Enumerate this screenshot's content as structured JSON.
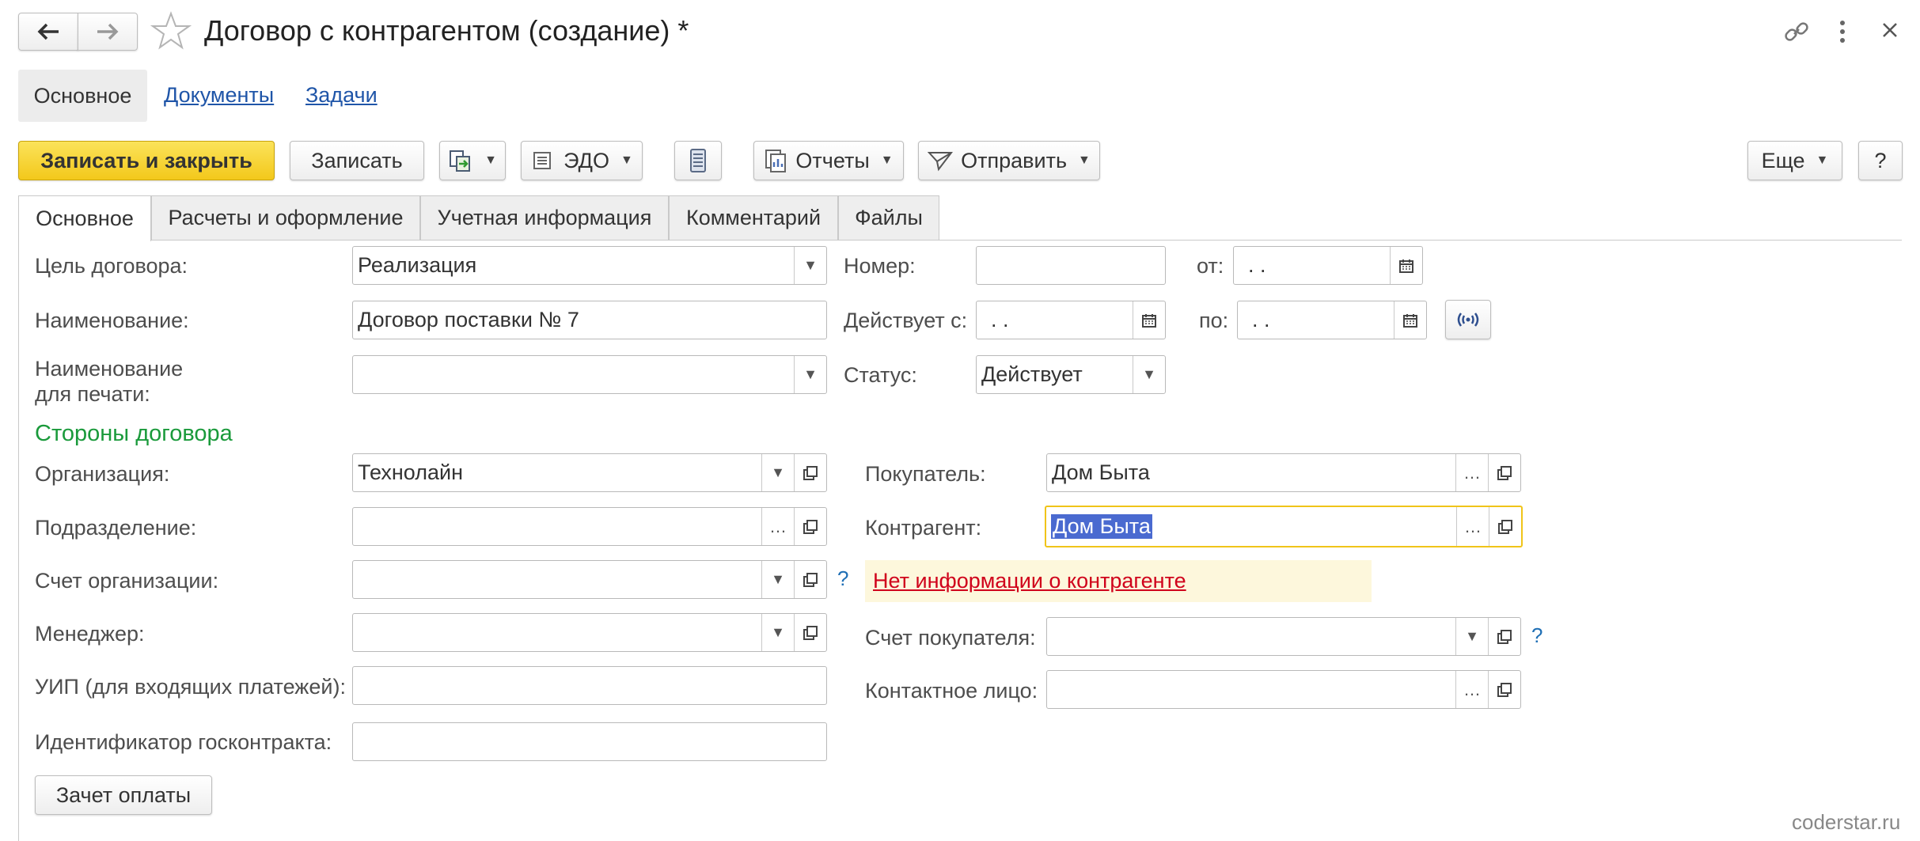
{
  "window": {
    "title": "Договор с контрагентом (создание) *"
  },
  "nav": {
    "items": [
      {
        "label": "Основное",
        "active": true
      },
      {
        "label": "Документы",
        "active": false
      },
      {
        "label": "Задачи",
        "active": false
      }
    ]
  },
  "toolbar": {
    "save_close": "Записать и закрыть",
    "save": "Записать",
    "edo": "ЭДО",
    "reports": "Отчеты",
    "send": "Отправить",
    "more": "Еще",
    "help": "?"
  },
  "tabs": [
    {
      "label": "Основное",
      "active": true
    },
    {
      "label": "Расчеты и оформление",
      "active": false
    },
    {
      "label": "Учетная информация",
      "active": false
    },
    {
      "label": "Комментарий",
      "active": false
    },
    {
      "label": "Файлы",
      "active": false
    }
  ],
  "form": {
    "purpose_label": "Цель договора:",
    "purpose_value": "Реализация",
    "name_label": "Наименование:",
    "name_value": "Договор поставки № 7",
    "print_name_label_1": "Наименование",
    "print_name_label_2": "для печати:",
    "print_name_value": "",
    "number_label": "Номер:",
    "number_value": "",
    "from_label": "от:",
    "from_value": " .  . ",
    "valid_from_label": "Действует с:",
    "valid_from_value": " .  . ",
    "valid_to_label": "по:",
    "valid_to_value": " .  . ",
    "status_label": "Статус:",
    "status_value": "Действует"
  },
  "parties": {
    "heading": "Стороны договора",
    "org_label": "Организация:",
    "org_value": "Технолайн",
    "dept_label": "Подразделение:",
    "dept_value": "",
    "org_account_label": "Счет организации:",
    "org_account_value": "",
    "manager_label": "Менеджер:",
    "manager_value": "",
    "uip_label": "УИП (для входящих платежей):",
    "uip_value": "",
    "gov_id_label": "Идентификатор госконтракта:",
    "gov_id_value": "",
    "buyer_label": "Покупатель:",
    "buyer_value": "Дом Быта",
    "counterparty_label": "Контрагент:",
    "counterparty_value": "Дом Быта",
    "warning": "Нет информации о контрагенте",
    "buyer_account_label": "Счет покупателя:",
    "buyer_account_value": "",
    "contact_label": "Контактное лицо:",
    "contact_value": "",
    "offset_button": "Зачет оплаты",
    "help_mark": "?"
  },
  "footer": {
    "watermark": "coderstar.ru"
  },
  "colors": {
    "accent_yellow": "#f6cd26",
    "heading_green": "#1a9a3b",
    "link_blue": "#1f55a8",
    "warning_red": "#d0021b",
    "warning_bg": "#fdf7dc",
    "selection": "#4a6ad0"
  }
}
